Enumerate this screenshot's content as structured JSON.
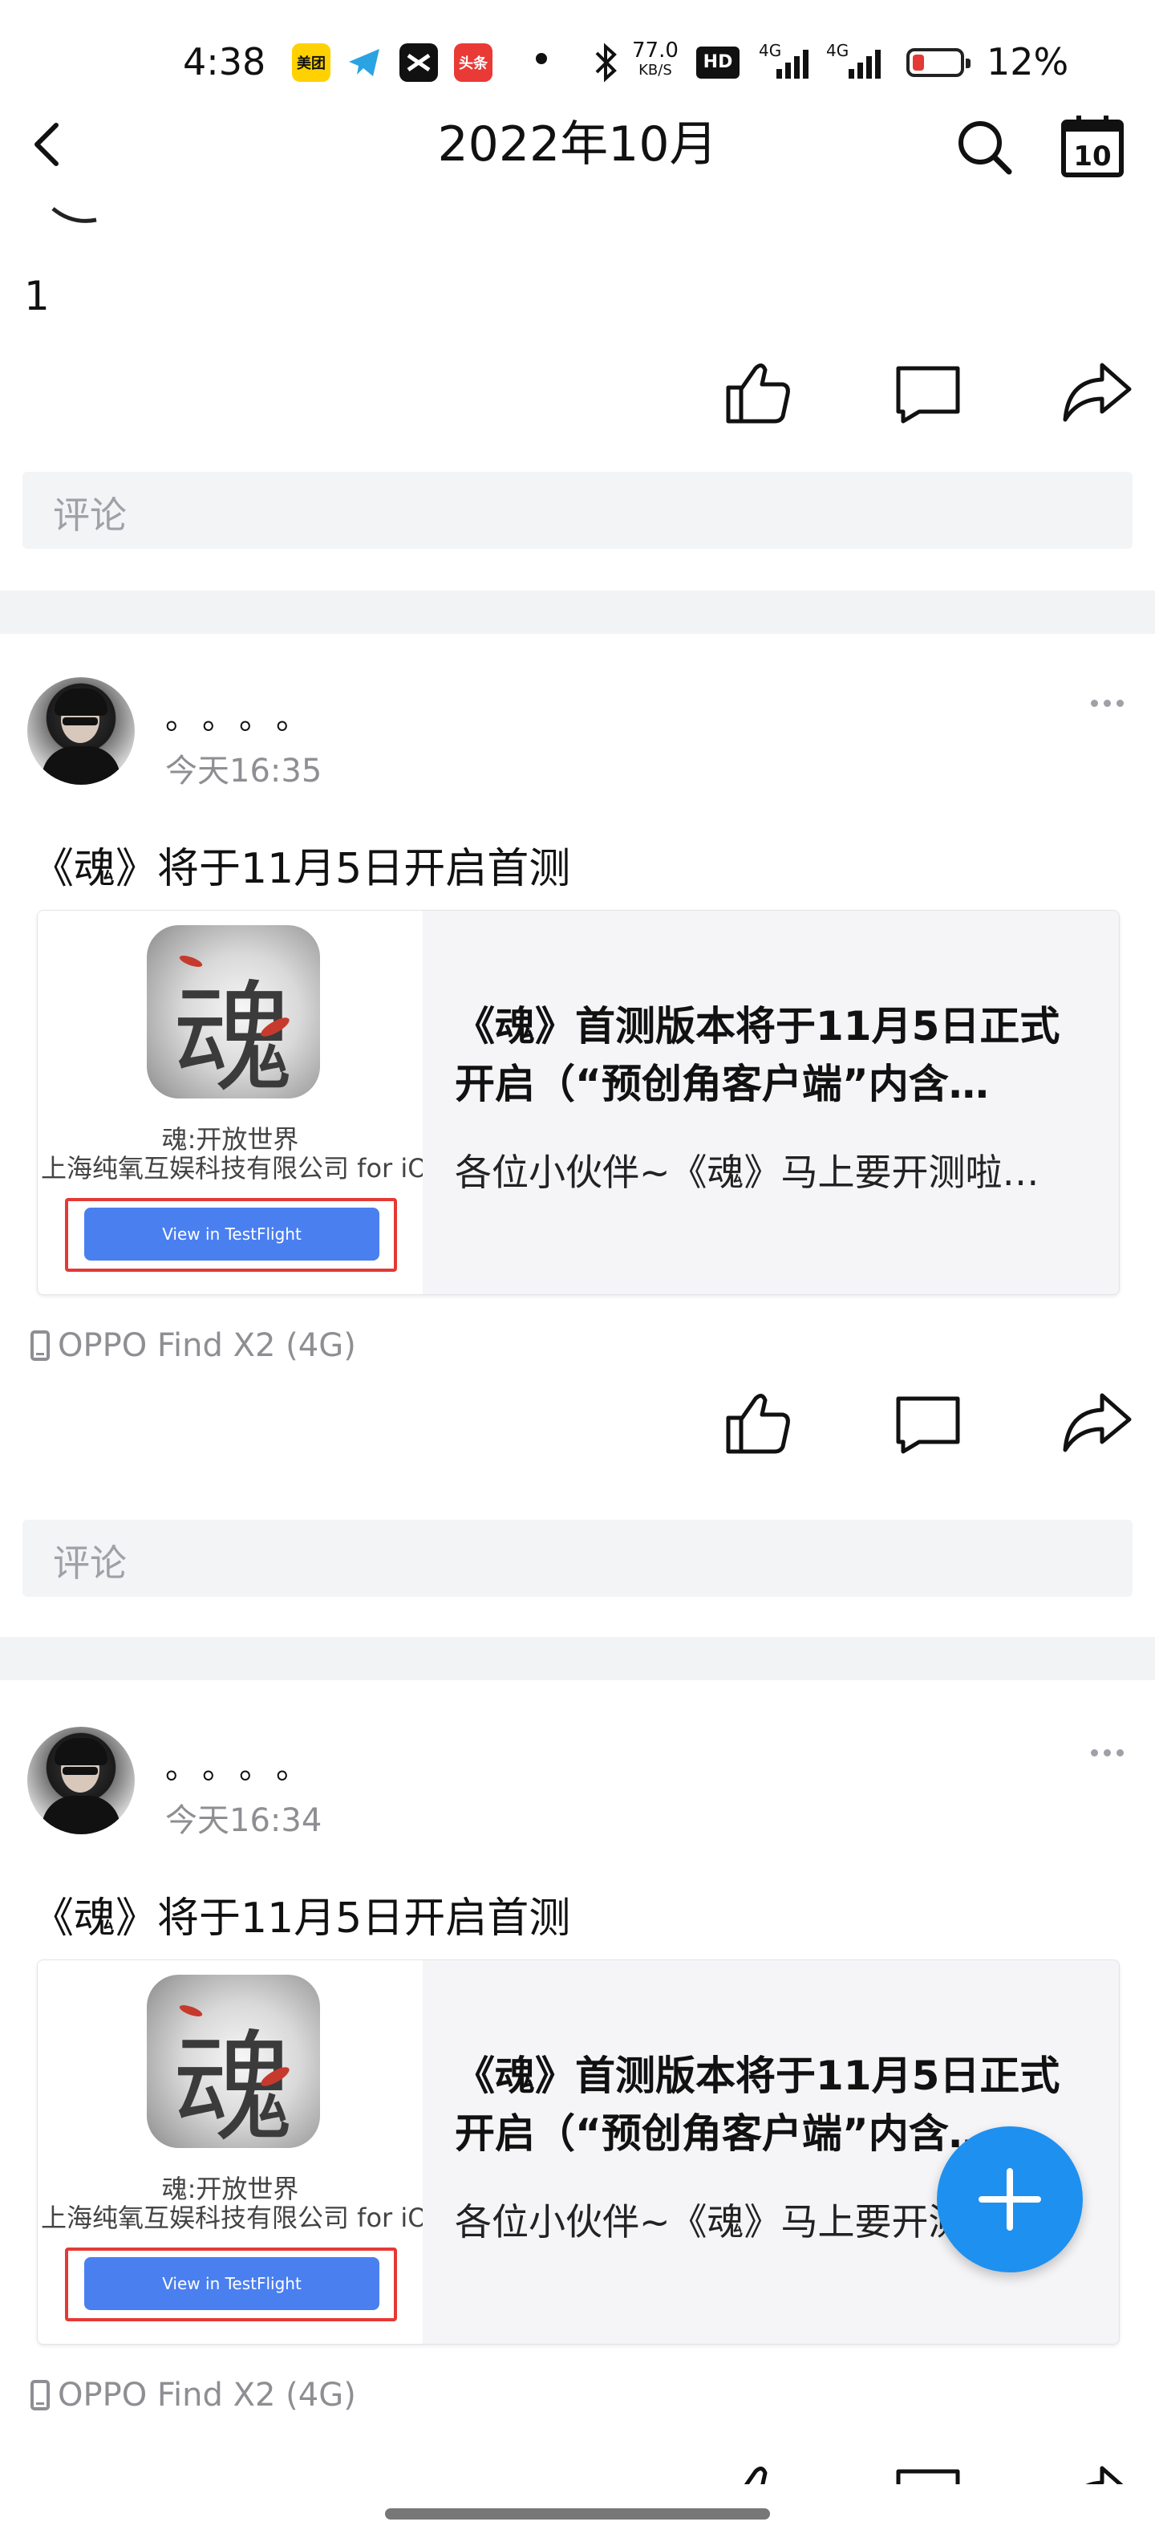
{
  "status_bar": {
    "time": "4:38",
    "app_icons": [
      {
        "name": "meituan-icon",
        "label": "美团",
        "color": "#ffd100"
      },
      {
        "name": "telegram-icon",
        "label": "",
        "color": "#2aa3e3"
      },
      {
        "name": "capcut-icon",
        "label": "",
        "color": "#111111"
      },
      {
        "name": "toutiao-icon",
        "label": "头条",
        "color": "#e93a36"
      }
    ],
    "speed_value": "77.0",
    "speed_unit": "KB/S",
    "hd_label": "HD",
    "net1": "4G",
    "net2": "4G",
    "battery_percent": "12%",
    "battery_level": 0.12
  },
  "nav": {
    "title": "2022年10月",
    "calendar_day": "10"
  },
  "top_partial": {
    "post_text": "1",
    "comment_placeholder": "评论"
  },
  "posts": [
    {
      "username": "。。。。",
      "time": "今天16:35",
      "text": "《魂》将于11月5日开启首测",
      "card": {
        "thumb_glyph": "魂",
        "thumb_app_name": "魂:开放世界",
        "thumb_developer": "上海纯氧互娱科技有限公司 for iOS",
        "thumb_button": "View in TestFlight",
        "title": "《魂》首测版本将于11月5日正式开启（“预创角客户端”内含…",
        "description": "各位小伙伴~《魂》马上要开测啦…"
      },
      "device": "OPPO Find X2 (4G)",
      "comment_placeholder": "评论"
    },
    {
      "username": "。。。。",
      "time": "今天16:34",
      "text": "《魂》将于11月5日开启首测",
      "card": {
        "thumb_glyph": "魂",
        "thumb_app_name": "魂:开放世界",
        "thumb_developer": "上海纯氧互娱科技有限公司 for iOS",
        "thumb_button": "View in TestFlight",
        "title": "《魂》首测版本将于11月5日正式开启（“预创角客户端”内含…",
        "description": "各位小伙伴~《魂》马上要开测啦…"
      },
      "device": "OPPO Find X2 (4G)"
    }
  ],
  "colors": {
    "accent_fab": "#1e90f0",
    "testflight_button": "#4a7ff0",
    "highlight_border": "#e53935"
  }
}
